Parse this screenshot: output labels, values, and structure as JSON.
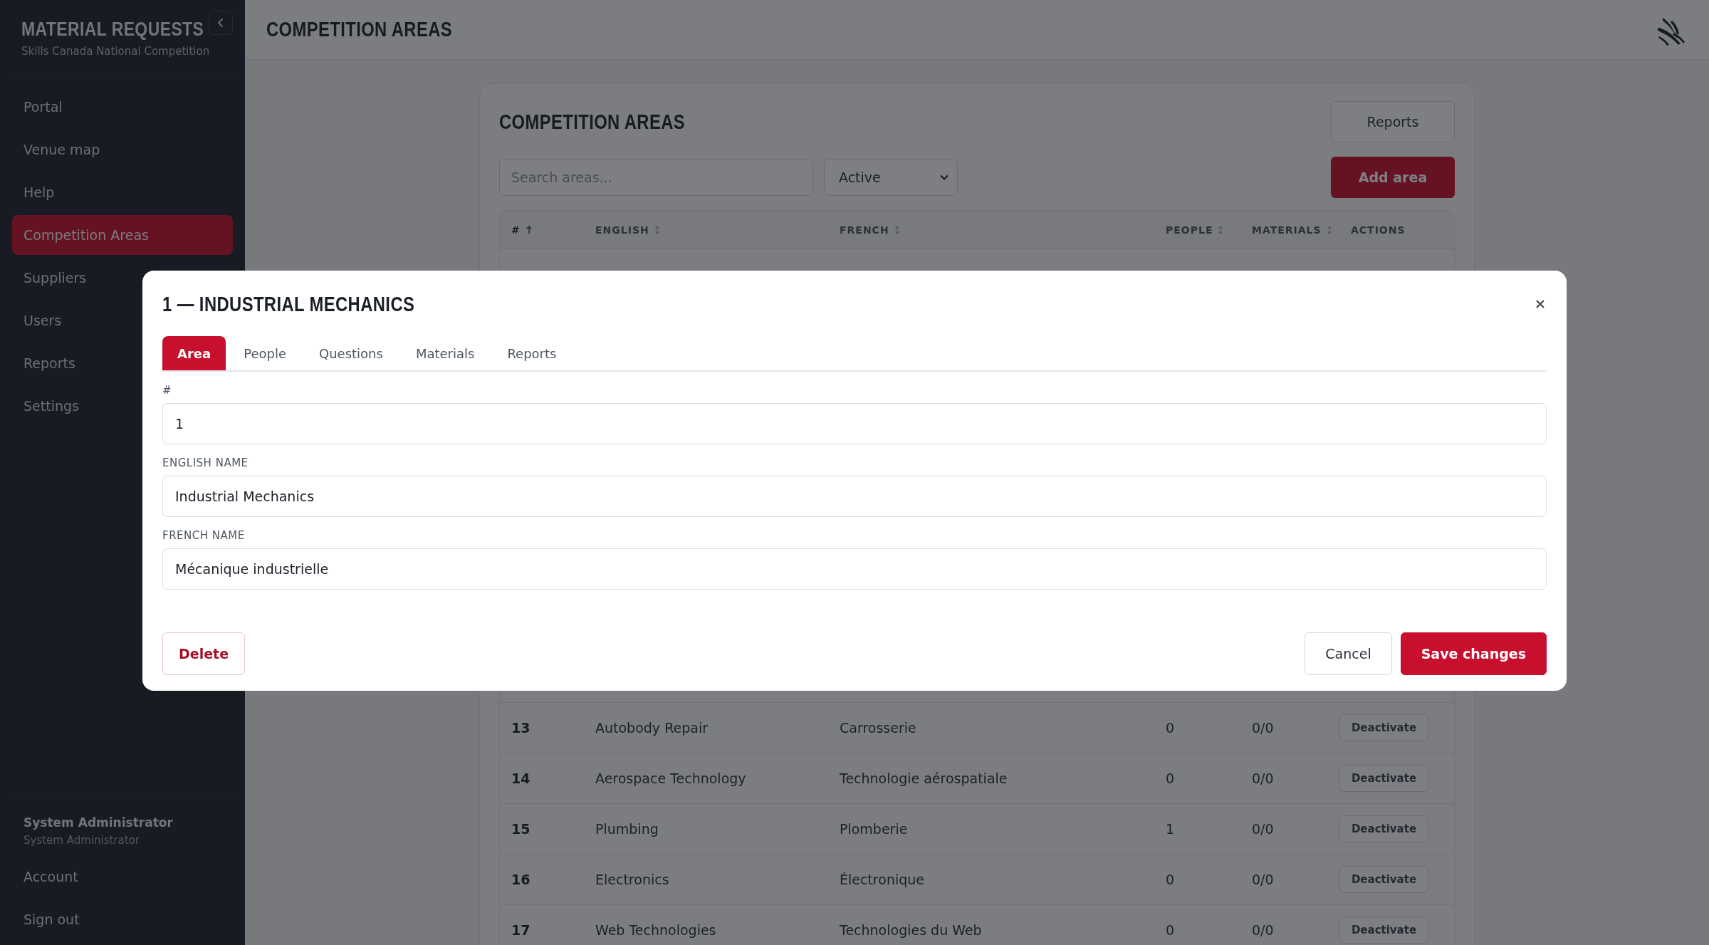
{
  "sidebar": {
    "title": "MATERIAL REQUESTS",
    "subtitle": "Skills Canada National Competition",
    "items": [
      {
        "label": "Portal",
        "selected": false
      },
      {
        "label": "Venue map",
        "selected": false
      },
      {
        "label": "Help",
        "selected": false
      },
      {
        "label": "Competition Areas",
        "selected": true
      },
      {
        "label": "Suppliers",
        "selected": false
      },
      {
        "label": "Users",
        "selected": false
      },
      {
        "label": "Reports",
        "selected": false
      },
      {
        "label": "Settings",
        "selected": false
      }
    ],
    "user": {
      "name": "System Administrator",
      "role": "System Administrator"
    },
    "footer_items": [
      "Account",
      "Sign out"
    ]
  },
  "topbar": {
    "title": "COMPETITION AREAS"
  },
  "card": {
    "title": "COMPETITION AREAS",
    "reports_button": "Reports",
    "search": {
      "placeholder": "Search areas..."
    },
    "status_filter": {
      "value": "Active"
    },
    "add_button": "Add area",
    "table": {
      "columns": [
        {
          "label": "#",
          "sortable": true,
          "sorted": true
        },
        {
          "label": "ENGLISH",
          "sortable": true,
          "sorted": false
        },
        {
          "label": "FRENCH",
          "sortable": true,
          "sorted": false
        },
        {
          "label": "PEOPLE",
          "sortable": true,
          "sorted": false
        },
        {
          "label": "MATERIALS",
          "sortable": true,
          "sorted": false
        },
        {
          "label": "ACTIONS",
          "sortable": false,
          "sorted": false
        }
      ],
      "rows": [
        {
          "number": "13",
          "english": "Autobody Repair",
          "french": "Carrosserie",
          "people": "0",
          "materials": "0/0",
          "action": "Deactivate"
        },
        {
          "number": "14",
          "english": "Aerospace Technology",
          "french": "Technologie aérospatiale",
          "people": "0",
          "materials": "0/0",
          "action": "Deactivate"
        },
        {
          "number": "15",
          "english": "Plumbing",
          "french": "Plomberie",
          "people": "1",
          "materials": "0/0",
          "action": "Deactivate"
        },
        {
          "number": "16",
          "english": "Electronics",
          "french": "Électronique",
          "people": "0",
          "materials": "0/0",
          "action": "Deactivate"
        },
        {
          "number": "17",
          "english": "Web Technologies",
          "french": "Technologies du Web",
          "people": "0",
          "materials": "0/0",
          "action": "Deactivate"
        }
      ]
    }
  },
  "modal": {
    "title": "1 — INDUSTRIAL MECHANICS",
    "tabs": [
      {
        "label": "Area",
        "selected": true
      },
      {
        "label": "People",
        "selected": false
      },
      {
        "label": "Questions",
        "selected": false
      },
      {
        "label": "Materials",
        "selected": false
      },
      {
        "label": "Reports",
        "selected": false
      }
    ],
    "fields": [
      {
        "label": "#",
        "value": "1"
      },
      {
        "label": "ENGLISH NAME",
        "value": "Industrial Mechanics"
      },
      {
        "label": "FRENCH NAME",
        "value": "Mécanique industrielle"
      }
    ],
    "delete_button": "Delete",
    "cancel_button": "Cancel",
    "save_button": "Save changes"
  }
}
